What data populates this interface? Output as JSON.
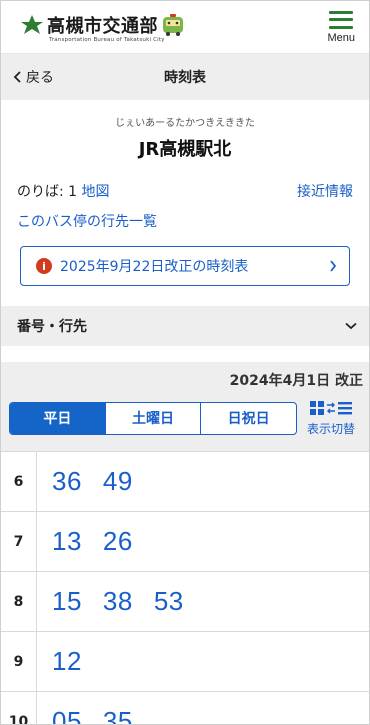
{
  "header": {
    "logo_title": "高槻市交通部",
    "logo_subtitle": "Transportation Bureau of Takatsuki City",
    "menu_label": "Menu"
  },
  "navbar": {
    "back_label": "戻る",
    "title": "時刻表"
  },
  "stop": {
    "kana": "じぇいあーるたかつきえききた",
    "name": "JR高槻駅北",
    "platform_label": "のりば: 1",
    "map_link": "地図",
    "approach_link": "接近情報",
    "destinations_link": "このバス停の行先一覧",
    "notice": "2025年9月22日改正の時刻表"
  },
  "route": {
    "label": "番号・行先"
  },
  "timetable": {
    "revision": "2024年4月1日 改正",
    "tabs": [
      "平日",
      "土曜日",
      "日祝日"
    ],
    "active_tab": "平日",
    "toggle_label": "表示切替",
    "rows": [
      {
        "hour": "6",
        "minutes": [
          "36",
          "49"
        ]
      },
      {
        "hour": "7",
        "minutes": [
          "13",
          "26"
        ]
      },
      {
        "hour": "8",
        "minutes": [
          "15",
          "38",
          "53"
        ]
      },
      {
        "hour": "9",
        "minutes": [
          "12"
        ]
      },
      {
        "hour": "10",
        "minutes": [
          "05",
          "35"
        ]
      }
    ]
  },
  "colors": {
    "accent": "#1a5fc9",
    "brand_green": "#2e7d32",
    "notice_red": "#d23c1e"
  }
}
